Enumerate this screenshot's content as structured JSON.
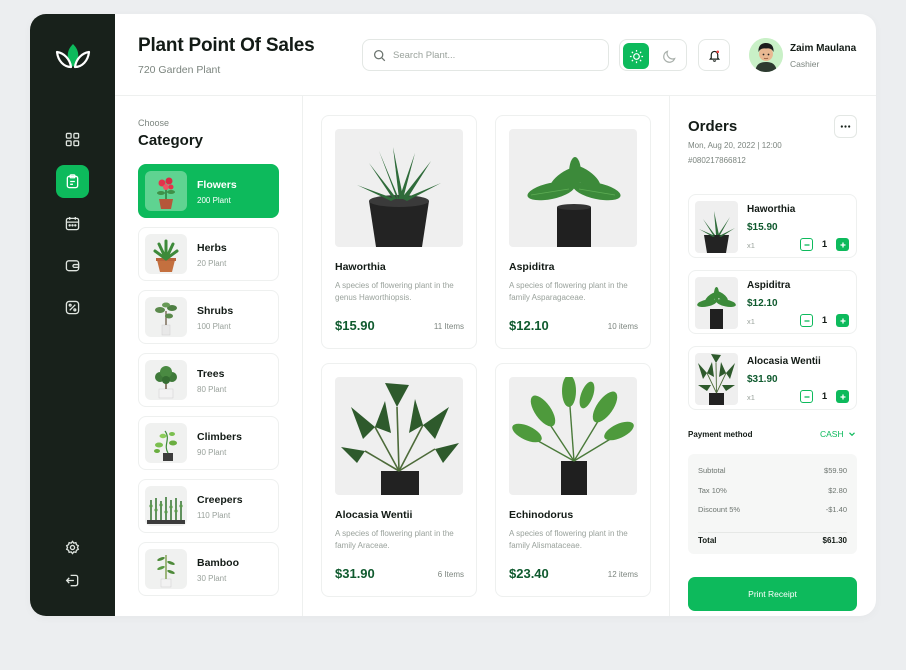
{
  "colors": {
    "accent": "#0dba5c",
    "sidebar": "#18211b",
    "price": "#0f5a2e"
  },
  "header": {
    "title": "Plant Point Of Sales",
    "subtitle": "720 Garden Plant",
    "search_placeholder": "Search Plant...",
    "user": {
      "name": "Zaim Maulana",
      "role": "Cashier"
    }
  },
  "sidebar": {
    "items": [
      {
        "icon": "grid-icon"
      },
      {
        "icon": "clipboard-icon",
        "active": true
      },
      {
        "icon": "calendar-icon"
      },
      {
        "icon": "wallet-icon"
      },
      {
        "icon": "discount-icon"
      },
      {
        "icon": "settings-icon"
      },
      {
        "icon": "logout-icon"
      }
    ]
  },
  "category": {
    "choose_label": "Choose",
    "title": "Category",
    "items": [
      {
        "name": "Flowers",
        "count": "200 Plant",
        "active": true
      },
      {
        "name": "Herbs",
        "count": "20 Plant"
      },
      {
        "name": "Shrubs",
        "count": "100 Plant"
      },
      {
        "name": "Trees",
        "count": "80 Plant"
      },
      {
        "name": "Climbers",
        "count": "90 Plant"
      },
      {
        "name": "Creepers",
        "count": "110 Plant"
      },
      {
        "name": "Bamboo",
        "count": "30 Plant"
      }
    ]
  },
  "products": [
    {
      "name": "Haworthia",
      "desc": "A species of flowering plant in the genus Haworthiopsis.",
      "price": "$15.90",
      "stock": "11 Items"
    },
    {
      "name": "Aspiditra",
      "desc": "A species of flowering plant in the family Asparagaceae.",
      "price": "$12.10",
      "stock": "10 items"
    },
    {
      "name": "Alocasia Wentii",
      "desc": "A species of flowering plant in the family Araceae.",
      "price": "$31.90",
      "stock": "6 Items"
    },
    {
      "name": "Echinodorus",
      "desc": "A species of flowering plant in the family Alismataceae.",
      "price": "$23.40",
      "stock": "12 items"
    }
  ],
  "orders": {
    "title": "Orders",
    "date": "Mon, Aug 20, 2022 | 12:00",
    "order_id": "#080217866812",
    "items": [
      {
        "name": "Haworthia",
        "price": "$15.90",
        "qty_label": "x1",
        "qty": "1"
      },
      {
        "name": "Aspiditra",
        "price": "$12.10",
        "qty_label": "x1",
        "qty": "1"
      },
      {
        "name": "Alocasia Wentii",
        "price": "$31.90",
        "qty_label": "x1",
        "qty": "1"
      }
    ],
    "payment": {
      "label": "Payment method",
      "value": "CASH"
    },
    "summary": {
      "subtotal_label": "Subtotal",
      "subtotal": "$59.90",
      "tax_label": "Tax 10%",
      "tax": "$2.80",
      "discount_label": "Discount 5%",
      "discount": "-$1.40",
      "total_label": "Total",
      "total": "$61.30"
    },
    "print_label": "Print Receipt"
  }
}
